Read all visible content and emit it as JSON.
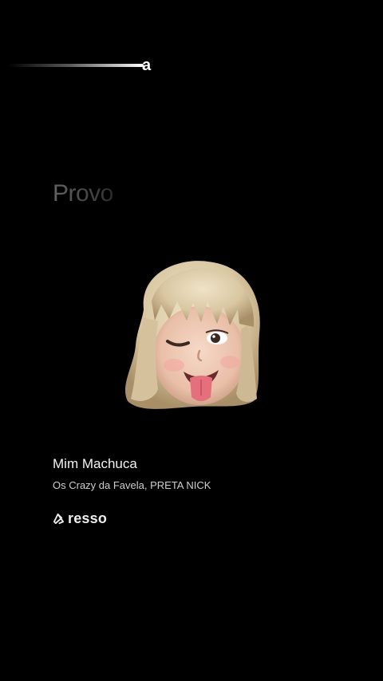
{
  "progress": {
    "letter": "a"
  },
  "lyrics": {
    "current_line": "Provo"
  },
  "track": {
    "title": "Mim Machuca",
    "artists": "Os Crazy da Favela, PRETA NICK"
  },
  "brand": {
    "name": "resso",
    "icon": "resso-logo-icon"
  },
  "colors": {
    "background": "#000000",
    "text_primary": "#f2f2f2",
    "text_secondary": "#cfcfcf"
  }
}
